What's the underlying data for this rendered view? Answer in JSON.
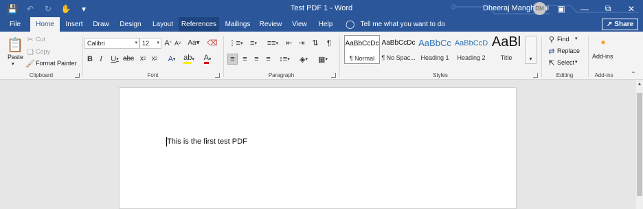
{
  "titlebar": {
    "doc_title": "Test PDF 1  -  Word",
    "user_name": "Dheeraj Manghnani",
    "user_initials": "DM",
    "accent": "#2b579a"
  },
  "tabs": [
    "File",
    "Home",
    "Insert",
    "Draw",
    "Design",
    "Layout",
    "References",
    "Mailings",
    "Review",
    "View",
    "Help"
  ],
  "tell_me": "Tell me what you want to do",
  "share_label": "Share",
  "clipboard": {
    "paste": "Paste",
    "cut": "Cut",
    "copy": "Copy",
    "format_painter": "Format Painter",
    "label": "Clipboard"
  },
  "font": {
    "font_name": "Calibri",
    "font_size": "12",
    "label": "Font"
  },
  "paragraph": {
    "label": "Paragraph"
  },
  "styles": {
    "items": [
      {
        "sample": "AaBbCcDc",
        "name": "¶ Normal"
      },
      {
        "sample": "AaBbCcDc",
        "name": "¶ No Spac..."
      },
      {
        "sample": "AaBbCc",
        "name": "Heading 1"
      },
      {
        "sample": "AaBbCcD",
        "name": "Heading 2"
      },
      {
        "sample": "AaBl",
        "name": "Title"
      }
    ],
    "label": "Styles"
  },
  "editing": {
    "find": "Find",
    "replace": "Replace",
    "select": "Select",
    "label": "Editing"
  },
  "addins": {
    "button": "Add-ins",
    "label": "Add-ins"
  },
  "document": {
    "text": "This is the first test PDF"
  }
}
